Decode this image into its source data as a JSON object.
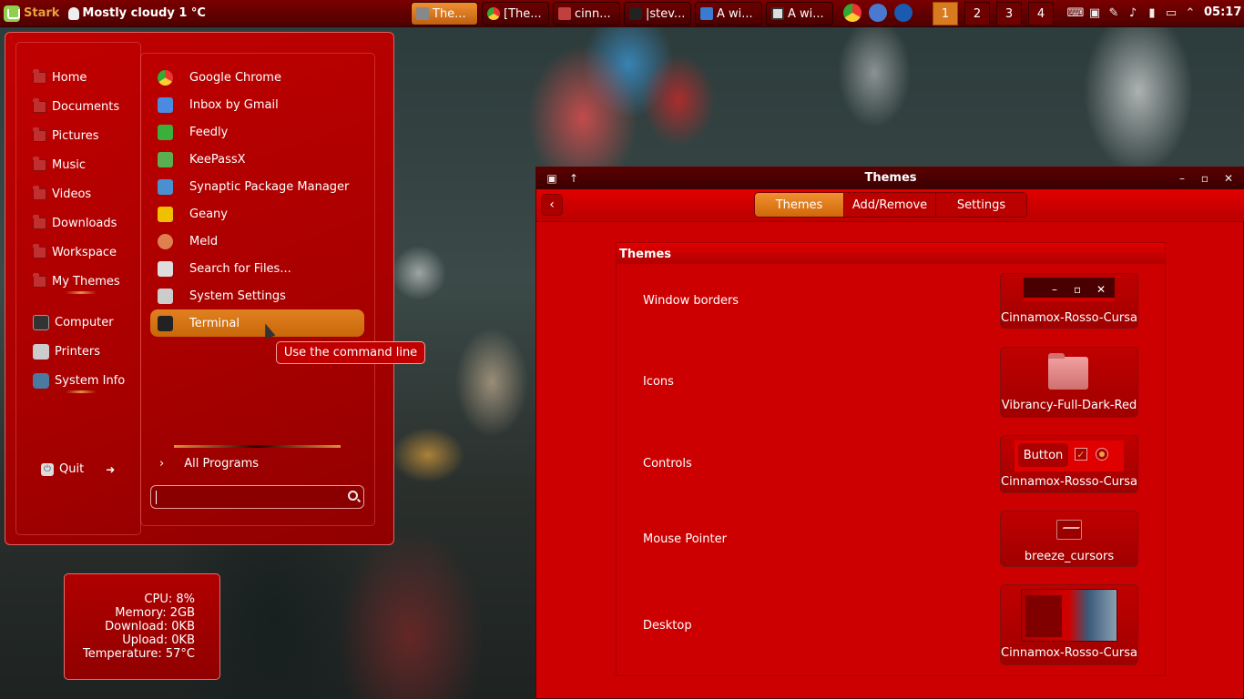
{
  "taskbar": {
    "menu_label": "Stark",
    "weather": "Mostly cloudy 1 °C",
    "windows": [
      "The...",
      "[The...",
      "cinn...",
      "|stev...",
      "A wi...",
      "A wi..."
    ],
    "workspaces": [
      "1",
      "2",
      "3",
      "4"
    ],
    "clock": "05:17"
  },
  "places": {
    "items": [
      "Home",
      "Documents",
      "Pictures",
      "Music",
      "Videos",
      "Downloads",
      "Workspace",
      "My Themes"
    ],
    "system": [
      "Computer",
      "Printers",
      "System Info"
    ],
    "quit": "Quit"
  },
  "apps": {
    "items": [
      "Google Chrome",
      "Inbox by Gmail",
      "Feedly",
      "KeePassX",
      "Synaptic Package Manager",
      "Geany",
      "Meld",
      "Search for Files...",
      "System Settings",
      "Terminal"
    ],
    "all_programs": "All Programs",
    "search_value": ""
  },
  "tooltip": "Use the command line",
  "sysmon": {
    "cpu": "CPU: 8%",
    "memory": "Memory: 2GB",
    "download": "Download: 0KB",
    "upload": "Upload: 0KB",
    "temperature": "Temperature: 57°C"
  },
  "themes_window": {
    "title": "Themes",
    "tabs": [
      "Themes",
      "Add/Remove",
      "Settings"
    ],
    "panel_title": "Themes",
    "rows": [
      {
        "label": "Window borders",
        "value": "Cinnamox-Rosso-Cursa"
      },
      {
        "label": "Icons",
        "value": "Vibrancy-Full-Dark-Red"
      },
      {
        "label": "Controls",
        "value": "Cinnamox-Rosso-Cursa"
      },
      {
        "label": "Mouse Pointer",
        "value": "breeze_cursors"
      },
      {
        "label": "Desktop",
        "value": "Cinnamox-Rosso-Cursa"
      }
    ],
    "controls_button": "Button"
  },
  "colors": {
    "accent": "#e08020",
    "window_bg": "#cc0000",
    "taskbar": "#5a0000"
  }
}
